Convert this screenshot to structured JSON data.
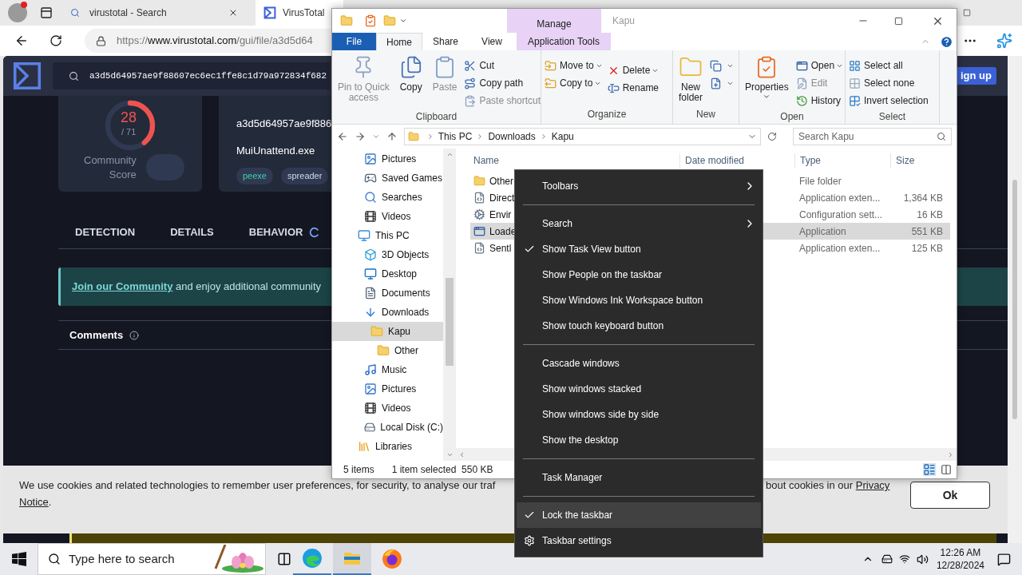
{
  "browser": {
    "tabs": [
      {
        "title": "virustotal - Search",
        "selected": false
      },
      {
        "title": "VirusTotal",
        "selected": true
      }
    ],
    "url": {
      "scheme": "https://",
      "host": "www.virustotal.com",
      "path": "/gui/file/a3d5d64"
    }
  },
  "virustotal": {
    "search_value": "a3d5d64957ae9f88607ec6ec1ffe8c1d79a972834f682",
    "sign_up": "ign up",
    "score": {
      "detections": "28",
      "total": "/ 71",
      "level": 0.39,
      "community_label": "Community\nScore"
    },
    "file": {
      "hash": "a3d5d64957ae9f886",
      "name": "MuiUnattend.exe",
      "tags": [
        {
          "label": "peexe",
          "color": "#3fd1a8"
        },
        {
          "label": "spreader",
          "color": "#d4d8e4"
        }
      ]
    },
    "tabs": [
      {
        "label": "DETECTION",
        "loading": false
      },
      {
        "label": "DETAILS",
        "loading": false
      },
      {
        "label": "BEHAVIOR",
        "loading": true
      }
    ],
    "banner": {
      "link": "Join our Community",
      "text": " and enjoy additional community"
    },
    "comments": "Comments",
    "cookie": {
      "text_left": "We use cookies and related technologies to remember user preferences, for security, to analyse our traf",
      "text_right": "bout cookies in our",
      "link_right": "Privacy",
      "link_line2": "Notice",
      "end": ".",
      "button": "Ok"
    }
  },
  "explorer": {
    "title": "Kapu",
    "context_tab": "Manage",
    "ribbon_tabs": [
      {
        "label": "File",
        "kind": "file",
        "selected": false
      },
      {
        "label": "Home",
        "kind": "tab",
        "selected": true
      },
      {
        "label": "Share",
        "kind": "tab",
        "selected": false
      },
      {
        "label": "View",
        "kind": "tab",
        "selected": false
      },
      {
        "label": "Application Tools",
        "kind": "context",
        "selected": false
      }
    ],
    "ribbon_groups": [
      {
        "name": "Clipboard",
        "items": [
          {
            "kind": "large",
            "label": "Pin to Quick\naccess",
            "disabled": true
          },
          {
            "kind": "large",
            "label": "Copy",
            "disabled": false
          },
          {
            "kind": "large",
            "label": "Paste",
            "disabled": true
          },
          {
            "kind": "small",
            "label": "Cut",
            "disabled": false
          },
          {
            "kind": "small",
            "label": "Copy path",
            "disabled": false
          },
          {
            "kind": "small",
            "label": "Paste shortcut",
            "disabled": true
          }
        ]
      },
      {
        "name": "Organize",
        "items": [
          {
            "kind": "small",
            "label": "Move to",
            "dropdown": true,
            "disabled": false
          },
          {
            "kind": "small",
            "label": "Copy to",
            "dropdown": true,
            "disabled": false
          },
          {
            "kind": "small",
            "label": "Delete",
            "dropdown": true,
            "disabled": false
          },
          {
            "kind": "small",
            "label": "Rename",
            "dropdown": false,
            "disabled": false
          }
        ]
      },
      {
        "name": "New",
        "items": [
          {
            "kind": "large",
            "label": "New\nfolder",
            "disabled": false
          },
          {
            "kind": "small",
            "dropdown": true,
            "disabled": false
          },
          {
            "kind": "small",
            "dropdown": true,
            "disabled": false
          }
        ]
      },
      {
        "name": "Open",
        "items": [
          {
            "kind": "large",
            "label": "Properties",
            "dropdown": true,
            "disabled": false
          },
          {
            "kind": "small",
            "label": "Open",
            "dropdown": true,
            "disabled": false
          },
          {
            "kind": "small",
            "label": "Edit",
            "dropdown": false,
            "disabled": true
          },
          {
            "kind": "small",
            "label": "History",
            "dropdown": false,
            "disabled": false
          }
        ]
      },
      {
        "name": "Select",
        "items": [
          {
            "kind": "small",
            "label": "Select all",
            "disabled": false
          },
          {
            "kind": "small",
            "label": "Select none",
            "disabled": false
          },
          {
            "kind": "small",
            "label": "Invert selection",
            "disabled": false
          }
        ]
      }
    ],
    "breadcrumb": [
      "This PC",
      "Downloads",
      "Kapu"
    ],
    "search_placeholder": "Search Kapu",
    "nav_tree": [
      {
        "children": [
          {
            "label": "Pictures",
            "kind": "pictures",
            "selected": false
          },
          {
            "label": "Saved Games",
            "kind": "games",
            "selected": false
          },
          {
            "label": "Searches",
            "kind": "search",
            "selected": false
          },
          {
            "label": "Videos",
            "kind": "videos",
            "selected": false
          }
        ]
      },
      {
        "label": "This PC",
        "kind": "pc",
        "selected": false,
        "children": [
          {
            "label": "3D Objects",
            "kind": "objects",
            "selected": false
          },
          {
            "label": "Desktop",
            "kind": "desktop",
            "selected": false
          },
          {
            "label": "Documents",
            "kind": "documents",
            "selected": false
          },
          {
            "label": "Downloads",
            "kind": "downloads",
            "selected": false,
            "children": [
              {
                "label": "Kapu",
                "kind": "folder",
                "selected": true,
                "children": [
                  {
                    "label": "Other",
                    "kind": "folder",
                    "selected": false
                  }
                ]
              }
            ]
          },
          {
            "label": "Music",
            "kind": "music",
            "selected": false
          },
          {
            "label": "Pictures",
            "kind": "pictures",
            "selected": false
          },
          {
            "label": "Videos",
            "kind": "videos",
            "selected": false
          },
          {
            "label": "Local Disk (C:)",
            "kind": "disk",
            "selected": false
          }
        ]
      },
      {
        "label": "Libraries",
        "kind": "libraries",
        "selected": false
      }
    ],
    "columns": [
      "Name",
      "Date modified",
      "Type",
      "Size"
    ],
    "files": [
      {
        "name": "Other",
        "kind": "folder",
        "type": "File folder",
        "selected": false
      },
      {
        "name": "Direct",
        "kind": "dll",
        "type": "Application exten...",
        "size": "1,364 KB",
        "selected": false
      },
      {
        "name": "Envir",
        "kind": "config",
        "type": "Configuration sett...",
        "size": "16 KB",
        "selected": false
      },
      {
        "name": "Loade",
        "kind": "app",
        "type": "Application",
        "size": "551 KB",
        "selected": true
      },
      {
        "name": "Sentl",
        "kind": "dll",
        "type": "Application exten...",
        "size": "125 KB",
        "selected": false
      }
    ],
    "status": {
      "count": "5 items",
      "selection": "1 item selected  550 KB"
    }
  },
  "context_menu": [
    {
      "kind": "submenu",
      "label": "Toolbars",
      "checked": false,
      "selected": false
    },
    {
      "kind": "separator"
    },
    {
      "kind": "submenu",
      "label": "Search",
      "checked": false,
      "selected": false
    },
    {
      "kind": "item",
      "label": "Show Task View button",
      "checked": true,
      "selected": false
    },
    {
      "kind": "item",
      "label": "Show People on the taskbar",
      "checked": false,
      "selected": false
    },
    {
      "kind": "item",
      "label": "Show Windows Ink Workspace button",
      "checked": false,
      "selected": false
    },
    {
      "kind": "item",
      "label": "Show touch keyboard button",
      "checked": false,
      "selected": false
    },
    {
      "kind": "separator"
    },
    {
      "kind": "item",
      "label": "Cascade windows",
      "checked": false,
      "selected": false
    },
    {
      "kind": "item",
      "label": "Show windows stacked",
      "checked": false,
      "selected": false
    },
    {
      "kind": "item",
      "label": "Show windows side by side",
      "checked": false,
      "selected": false
    },
    {
      "kind": "item",
      "label": "Show the desktop",
      "checked": false,
      "selected": false
    },
    {
      "kind": "separator"
    },
    {
      "kind": "item",
      "label": "Task Manager",
      "checked": false,
      "selected": false
    },
    {
      "kind": "separator"
    },
    {
      "kind": "item",
      "label": "Lock the taskbar",
      "checked": true,
      "selected": true
    },
    {
      "kind": "settings",
      "label": "Taskbar settings",
      "checked": false,
      "selected": false
    }
  ],
  "taskbar": {
    "search_placeholder": "Type here to search",
    "apps": [
      {
        "kind": "edge",
        "open": true,
        "selected": false
      },
      {
        "kind": "explorer",
        "open": true,
        "selected": true
      },
      {
        "kind": "firefox",
        "open": false,
        "selected": false
      }
    ],
    "time": "12:26 AM",
    "date": "12/28/2024"
  }
}
